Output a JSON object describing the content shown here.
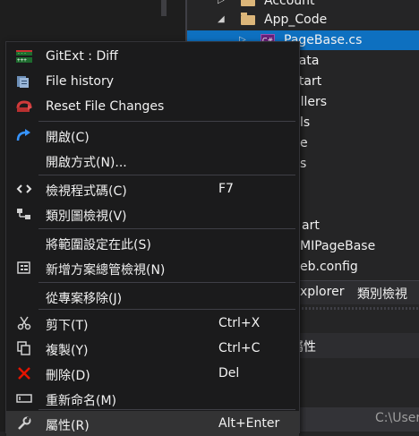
{
  "solution_explorer": {
    "items": [
      {
        "label": "Account"
      },
      {
        "label": "App_Code"
      },
      {
        "label": "PageBase.cs"
      },
      {
        "label": "Data"
      },
      {
        "label": "Start"
      },
      {
        "label": "ollers"
      },
      {
        "label": "ls"
      },
      {
        "label": "e"
      },
      {
        "label": "s"
      },
      {
        "label": "art"
      },
      {
        "label": "MIPageBase"
      },
      {
        "label": "eb.config"
      }
    ],
    "tabs": [
      "xplorer",
      "類別檢視"
    ],
    "properties_title": "屬性",
    "status_path": "C:\\User"
  },
  "context_menu": {
    "items": [
      {
        "label": "GitExt : Diff",
        "shortcut": "",
        "icon": "git-diff-icon"
      },
      {
        "label": "File history",
        "shortcut": "",
        "icon": "file-history-icon"
      },
      {
        "label": "Reset File Changes",
        "shortcut": "",
        "icon": "reset-changes-icon"
      },
      {
        "label": "開啟(C)",
        "shortcut": "",
        "icon": "open-arrow-icon"
      },
      {
        "label": "開啟方式(N)...",
        "shortcut": "",
        "icon": ""
      },
      {
        "label": "檢視程式碼(C)",
        "shortcut": "F7",
        "icon": "code-brackets-icon"
      },
      {
        "label": "類別圖檢視(V)",
        "shortcut": "",
        "icon": "class-diagram-icon"
      },
      {
        "label": "將範圍設定在此(S)",
        "shortcut": "",
        "icon": ""
      },
      {
        "label": "新增方案總管檢視(N)",
        "shortcut": "",
        "icon": "new-explorer-view-icon"
      },
      {
        "label": "從專案移除(J)",
        "shortcut": "",
        "icon": ""
      },
      {
        "label": "剪下(T)",
        "shortcut": "Ctrl+X",
        "icon": "scissors-icon"
      },
      {
        "label": "複製(Y)",
        "shortcut": "Ctrl+C",
        "icon": "copy-icon"
      },
      {
        "label": "刪除(D)",
        "shortcut": "Del",
        "icon": "delete-x-icon"
      },
      {
        "label": "重新命名(M)",
        "shortcut": "",
        "icon": "rename-icon"
      },
      {
        "label": "屬性(R)",
        "shortcut": "Alt+Enter",
        "icon": "wrench-icon"
      }
    ]
  },
  "colors": {
    "selection": "#0e70c0",
    "menu_background": "#1b1b1c",
    "hover": "#333334",
    "delete_red": "#e51400",
    "open_blue": "#3794ff"
  }
}
